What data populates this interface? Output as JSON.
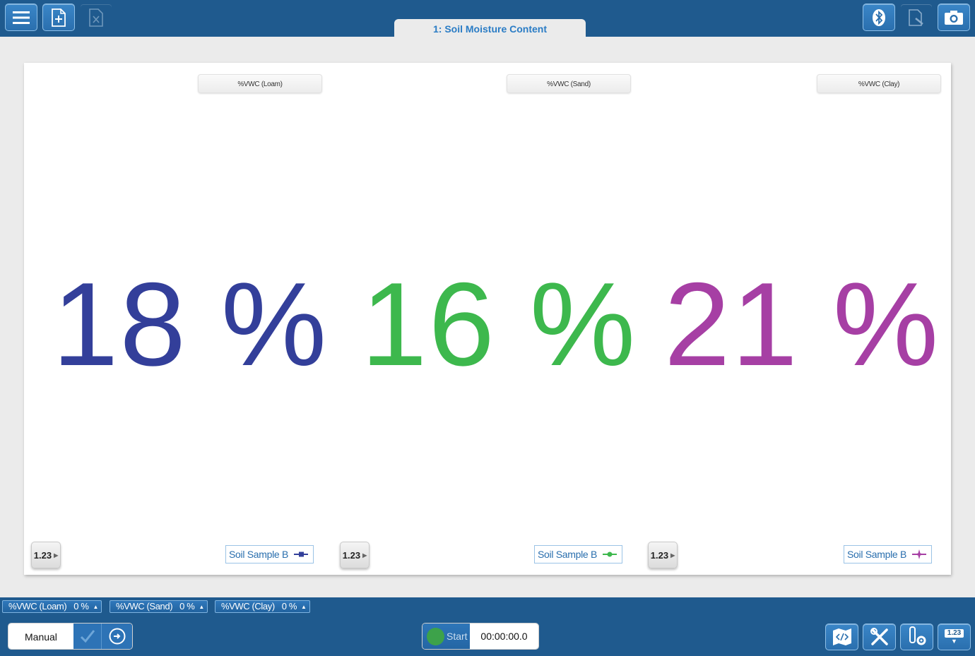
{
  "toolbar": {
    "menu_icon": "hamburger-icon",
    "new_page_icon": "add-page-icon",
    "delete_page_icon": "delete-page-icon",
    "bluetooth_icon": "bluetooth-icon",
    "annotate_icon": "annotate-icon",
    "camera_icon": "camera-icon"
  },
  "tab": {
    "label": "1: Soil Moisture Content"
  },
  "displays": [
    {
      "sensor": "%VWC (Loam)",
      "value": "18",
      "unit": "%",
      "color": "#333f9a",
      "format_label": "1.23",
      "legend": "Soil Sample B"
    },
    {
      "sensor": "%VWC (Sand)",
      "value": "16",
      "unit": "%",
      "color": "#3db84d",
      "format_label": "1.23",
      "legend": "Soil Sample B"
    },
    {
      "sensor": "%VWC (Clay)",
      "value": "21",
      "unit": "%",
      "color": "#a63fa4",
      "format_label": "1.23",
      "legend": "Soil Sample B"
    }
  ],
  "meters": [
    {
      "label": "%VWC (Loam)",
      "value": "0",
      "unit": "%"
    },
    {
      "label": "%VWC (Sand)",
      "value": "0",
      "unit": "%"
    },
    {
      "label": "%VWC (Clay)",
      "value": "0",
      "unit": "%"
    }
  ],
  "controls": {
    "mode_label": "Manual",
    "start_label": "Start",
    "timer": "00:00:00.0",
    "digits_label": "1.23"
  },
  "colors": {
    "accent": "#1f5a8e",
    "button": "#2a6fae"
  }
}
